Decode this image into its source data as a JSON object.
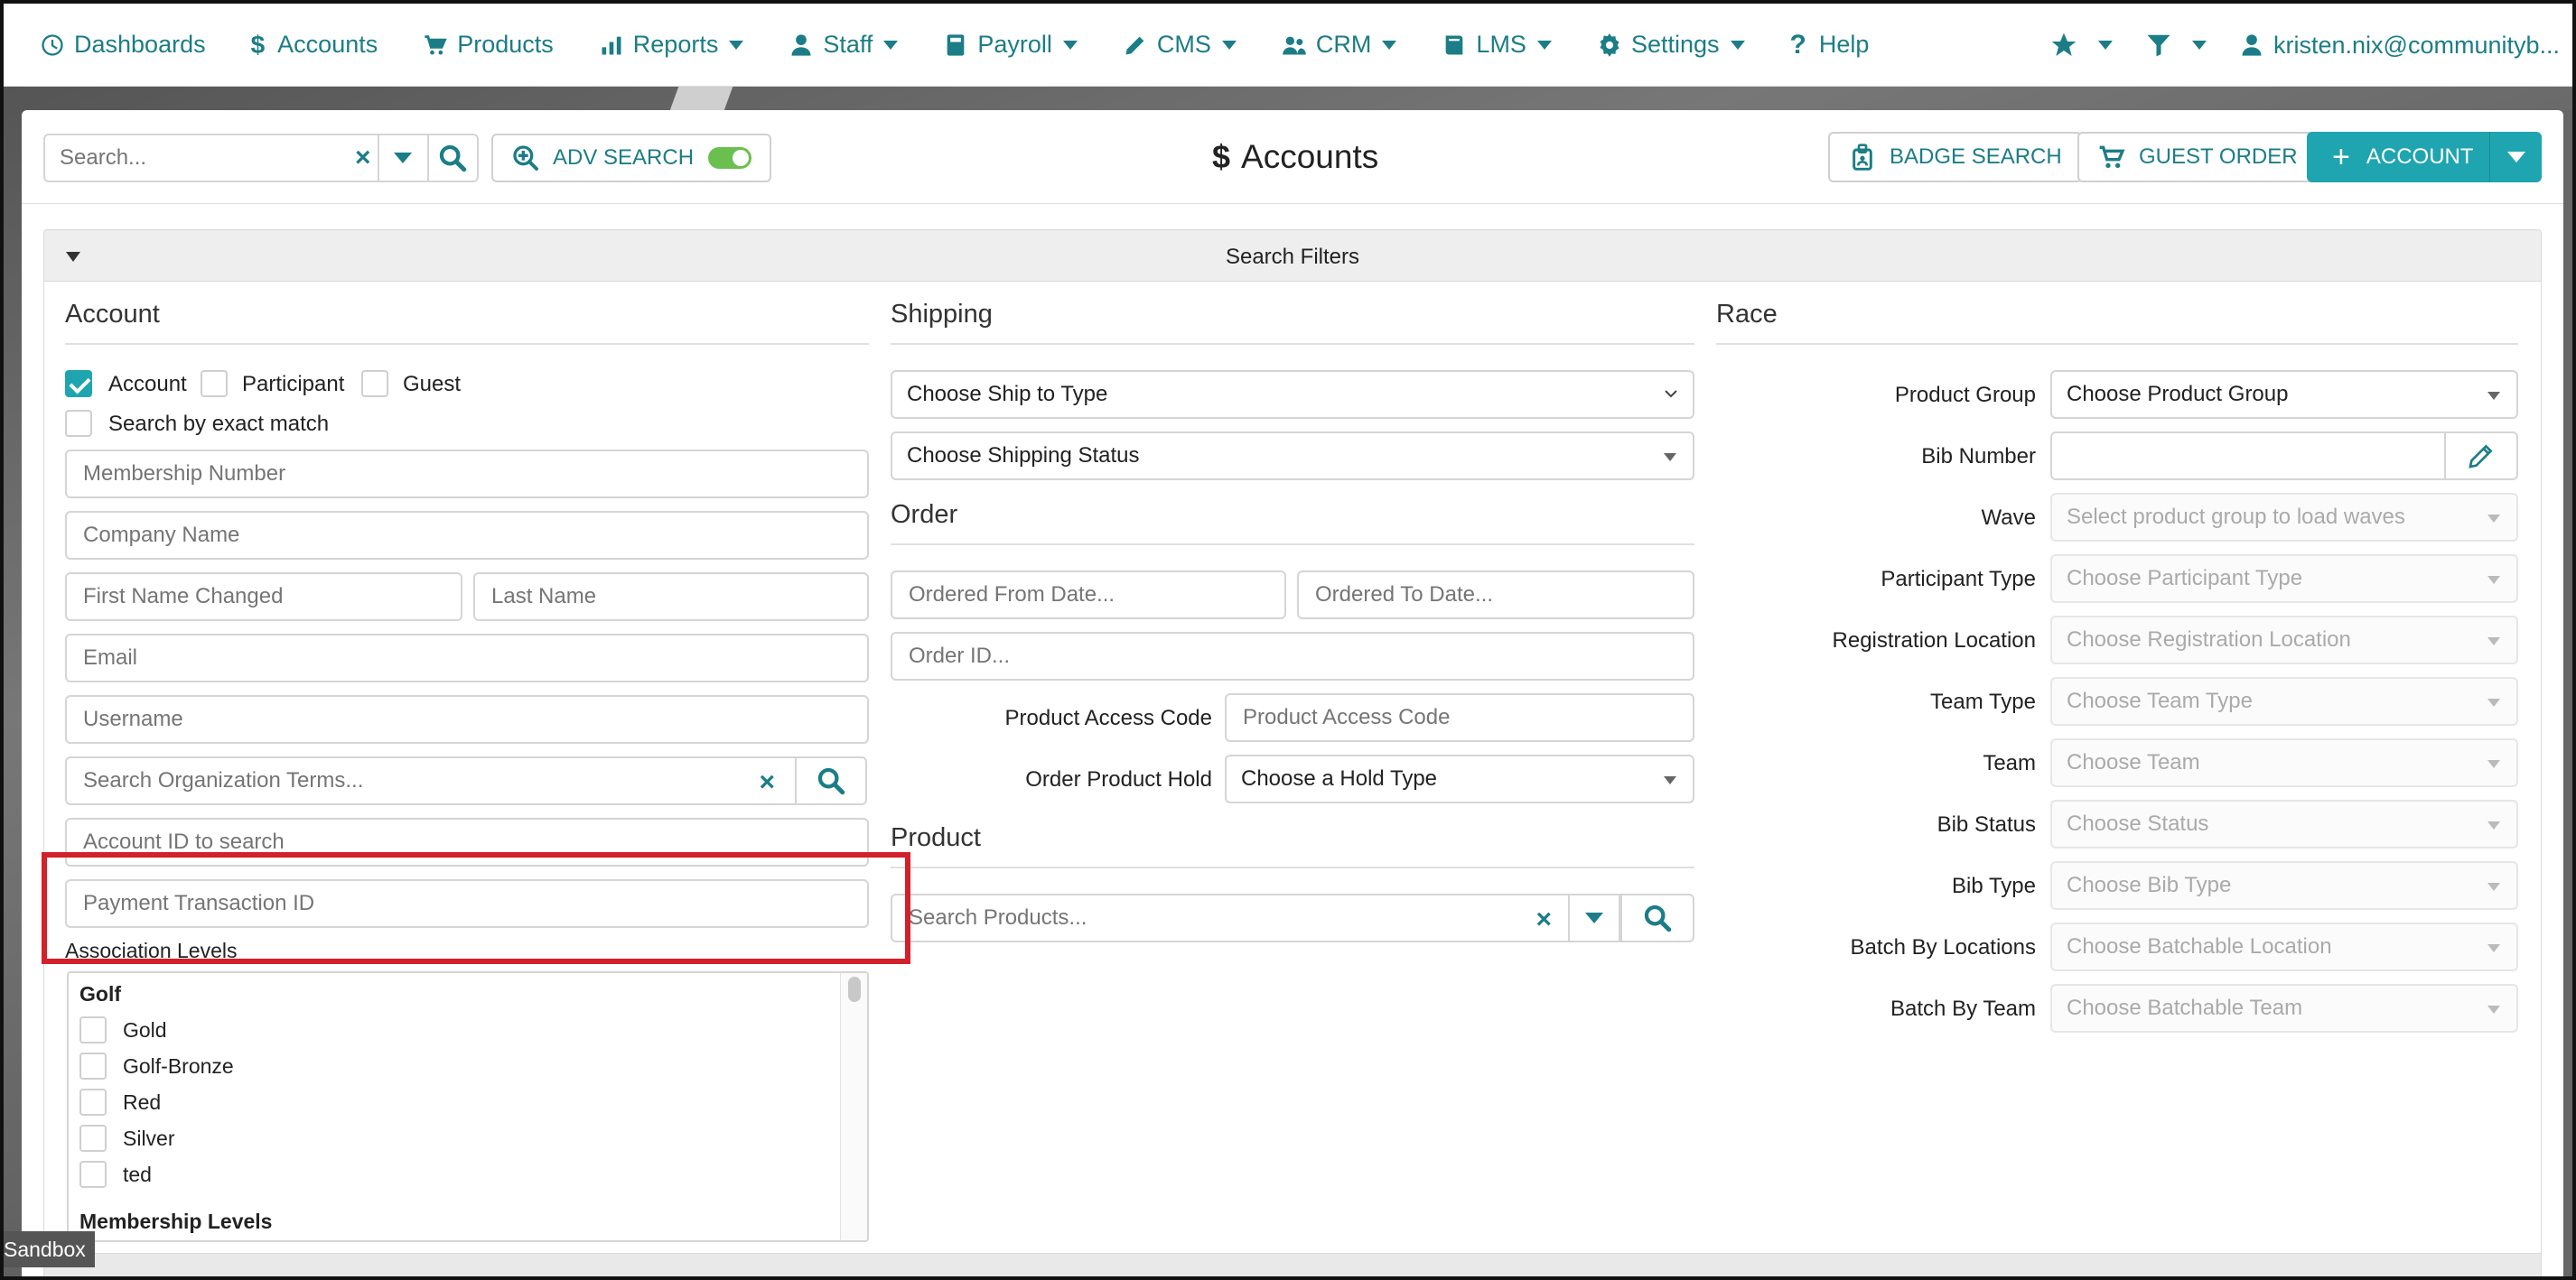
{
  "nav": {
    "items": [
      {
        "label": "Dashboards",
        "icon": "dashboard-icon",
        "caret": false
      },
      {
        "label": "Accounts",
        "icon": "dollar-icon",
        "caret": false
      },
      {
        "label": "Products",
        "icon": "cart-icon",
        "caret": false
      },
      {
        "label": "Reports",
        "icon": "chart-icon",
        "caret": true
      },
      {
        "label": "Staff",
        "icon": "person-icon",
        "caret": true
      },
      {
        "label": "Payroll",
        "icon": "payroll-icon",
        "caret": true
      },
      {
        "label": "CMS",
        "icon": "pencil-icon",
        "caret": true
      },
      {
        "label": "CRM",
        "icon": "people-icon",
        "caret": true
      },
      {
        "label": "LMS",
        "icon": "book-icon",
        "caret": true
      },
      {
        "label": "Settings",
        "icon": "gear-icon",
        "caret": true
      },
      {
        "label": "Help",
        "icon": "question-icon",
        "caret": false
      }
    ],
    "user_email": "kristen.nix@communityb..."
  },
  "toolbar": {
    "search_placeholder": "Search...",
    "adv_search_label": "ADV SEARCH",
    "adv_search_on": true,
    "title": "Accounts",
    "badge_search_label": "BADGE SEARCH",
    "guest_order_label": "GUEST ORDER",
    "add_account_label": "ACCOUNT"
  },
  "filters": {
    "header": "Search Filters",
    "account": {
      "title": "Account",
      "types": [
        {
          "label": "Account",
          "checked": true
        },
        {
          "label": "Participant",
          "checked": false
        },
        {
          "label": "Guest",
          "checked": false
        }
      ],
      "exact_match_label": "Search by exact match",
      "exact_match_checked": false,
      "membership_number_placeholder": "Membership Number",
      "company_name_placeholder": "Company Name",
      "first_name_placeholder": "First Name Changed",
      "last_name_placeholder": "Last Name",
      "email_placeholder": "Email",
      "username_placeholder": "Username",
      "org_terms_placeholder": "Search Organization Terms...",
      "account_id_placeholder": "Account ID to search",
      "payment_txn_placeholder": "Payment Transaction ID",
      "association_levels_label": "Association Levels",
      "groups": [
        {
          "title": "Golf",
          "items": [
            "Gold",
            "Golf-Bronze",
            "Red",
            "Silver",
            "ted"
          ]
        },
        {
          "title": "Membership Levels",
          "items": []
        }
      ]
    },
    "shipping": {
      "title": "Shipping",
      "ship_to_type": "Choose Ship to Type",
      "shipping_status": "Choose Shipping Status"
    },
    "order": {
      "title": "Order",
      "ordered_from_placeholder": "Ordered From Date...",
      "ordered_to_placeholder": "Ordered To Date...",
      "order_id_placeholder": "Order ID...",
      "product_access_code_label": "Product Access Code",
      "product_access_code_placeholder": "Product Access Code",
      "order_product_hold_label": "Order Product Hold",
      "order_product_hold_value": "Choose a Hold Type"
    },
    "product": {
      "title": "Product",
      "search_placeholder": "Search Products..."
    },
    "race": {
      "title": "Race",
      "rows": [
        {
          "label": "Product Group",
          "value": "Choose Product Group",
          "disabled": false
        },
        {
          "label": "Bib Number",
          "value": "",
          "disabled": false
        },
        {
          "label": "Wave",
          "value": "Select product group to load waves",
          "disabled": true
        },
        {
          "label": "Participant Type",
          "value": "Choose Participant Type",
          "disabled": true
        },
        {
          "label": "Registration Location",
          "value": "Choose Registration Location",
          "disabled": true
        },
        {
          "label": "Team Type",
          "value": "Choose Team Type",
          "disabled": true
        },
        {
          "label": "Team",
          "value": "Choose Team",
          "disabled": true
        },
        {
          "label": "Bib Status",
          "value": "Choose Status",
          "disabled": true
        },
        {
          "label": "Bib Type",
          "value": "Choose Bib Type",
          "disabled": true
        },
        {
          "label": "Batch By Locations",
          "value": "Choose Batchable Location",
          "disabled": true
        },
        {
          "label": "Batch By Team",
          "value": "Choose Batchable Team",
          "disabled": true
        }
      ]
    }
  },
  "environment_badge": "Sandbox",
  "colors": {
    "accent": "#1b7d87",
    "primary": "#1fa5b0",
    "highlight": "#d3202a",
    "toggle_on": "#6bbf4e"
  }
}
